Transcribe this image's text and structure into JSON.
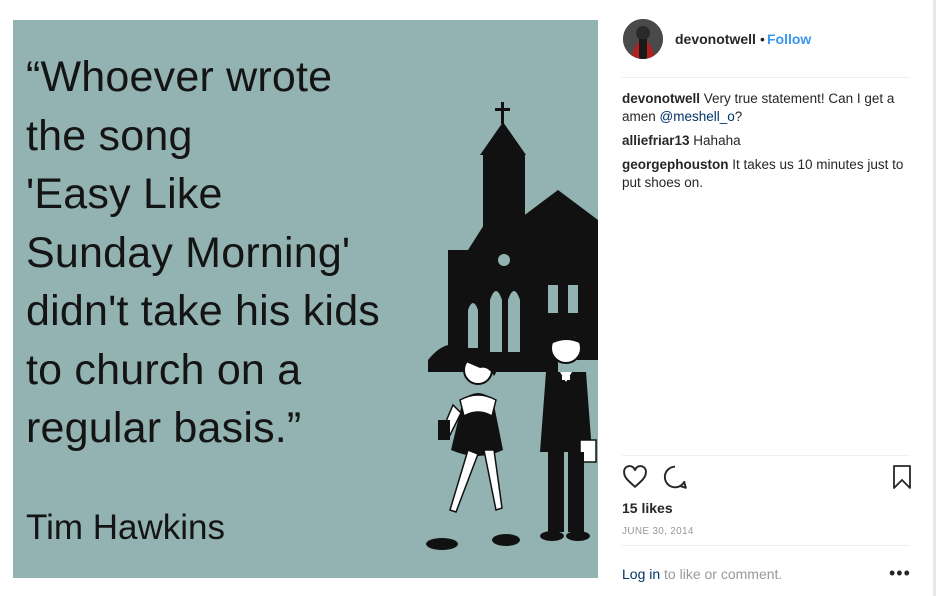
{
  "image": {
    "quote_lines": [
      "“Whoever wrote",
      "the song",
      "'Easy Like",
      "Sunday Morning'",
      "didn't take his kids",
      "to church on a",
      "regular basis.”"
    ],
    "author": "Tim Hawkins",
    "background_color": "#93b2b2"
  },
  "header": {
    "username": "devonotwell",
    "separator": "•",
    "follow_label": "Follow"
  },
  "comments": [
    {
      "user": "devonotwell",
      "text_before": " Very true statement! Can I get a amen ",
      "mention": "@meshell_o",
      "text_after": "?"
    },
    {
      "user": "alliefriar13",
      "text_before": " Hahaha",
      "mention": "",
      "text_after": ""
    },
    {
      "user": "georgephouston",
      "text_before": " It takes us 10 minutes just to put shoes on.",
      "mention": "",
      "text_after": ""
    }
  ],
  "actions": {
    "like_icon": "heart-icon",
    "comment_icon": "comment-icon",
    "save_icon": "bookmark-icon"
  },
  "likes": "15 likes",
  "date": "JUNE 30, 2014",
  "footer": {
    "login_label": "Log in",
    "login_suffix": " to like or comment.",
    "more_label": "•••"
  },
  "colors": {
    "link": "#3897f0",
    "mention": "#003569",
    "muted": "#999999"
  }
}
